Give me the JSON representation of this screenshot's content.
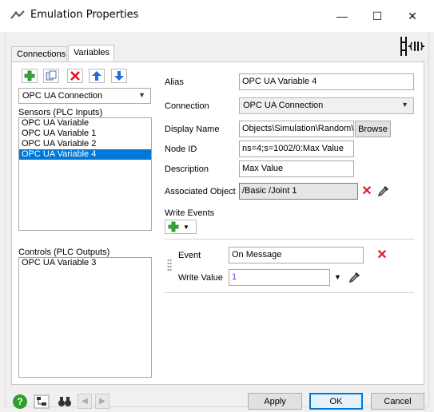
{
  "window": {
    "title": "Emulation Properties",
    "minimize_glyph": "—",
    "maximize_glyph": "☐",
    "close_glyph": "✕"
  },
  "tabs": [
    {
      "label": "Connections"
    },
    {
      "label": "Variables"
    }
  ],
  "toolbar": {
    "connection_combo": "OPC UA Connection"
  },
  "sensors": {
    "label": "Sensors (PLC Inputs)",
    "items": [
      "OPC UA Variable",
      "OPC UA Variable 1",
      "OPC UA Variable 2",
      "OPC UA Variable 4"
    ],
    "selected_index": 3
  },
  "controls": {
    "label": "Controls (PLC Outputs)",
    "items": [
      "OPC UA Variable 3"
    ]
  },
  "properties": {
    "alias_label": "Alias",
    "alias_value": "OPC UA Variable 4",
    "connection_label": "Connection",
    "connection_value": "OPC UA Connection",
    "display_name_label": "Display Name",
    "display_name_value": "Objects\\Simulation\\Random\\Random",
    "browse_label": "Browse",
    "node_id_label": "Node ID",
    "node_id_value": "ns=4;s=1002/0:Max Value",
    "description_label": "Description",
    "description_value": "Max Value",
    "associated_object_label": "Associated Object",
    "associated_object_value": "/Basic /Joint 1",
    "write_events_label": "Write Events",
    "event_label": "Event",
    "event_value": "On Message",
    "write_value_label": "Write Value",
    "write_value_value": "1"
  },
  "footer": {
    "apply_label": "Apply",
    "ok_label": "OK",
    "cancel_label": "Cancel"
  },
  "colors": {
    "selection": "#0078d7",
    "delete_red": "#e81123",
    "add_green": "#3aa53a",
    "arrow_blue": "#1e6fd9"
  }
}
